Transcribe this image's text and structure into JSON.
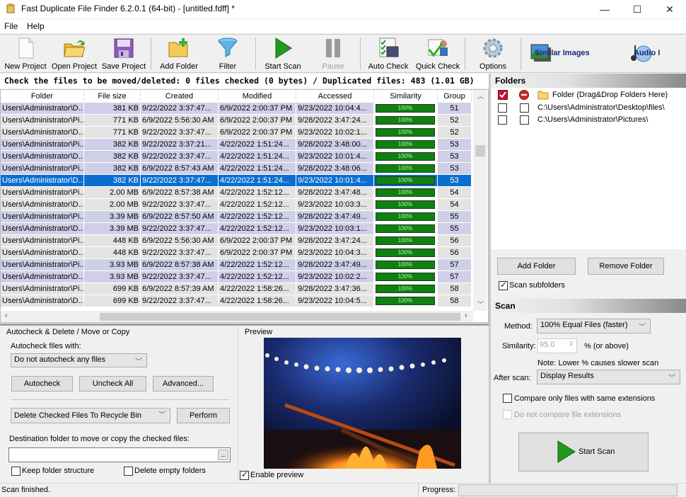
{
  "window": {
    "title": "Fast Duplicate File Finder 6.2.0.1 (64-bit) - [untitled.fdff] *",
    "minimize": "—",
    "maximize": "☐",
    "close": "✕"
  },
  "menu": [
    "File",
    "Help"
  ],
  "toolbar": {
    "buttons": [
      {
        "label": "New Project",
        "icon": "new-document-icon"
      },
      {
        "label": "Open Project",
        "icon": "open-folder-icon"
      },
      {
        "label": "Save Project",
        "icon": "save-floppy-icon"
      },
      {
        "label": "Add Folder",
        "icon": "add-folder-icon"
      },
      {
        "label": "Filter",
        "icon": "filter-funnel-icon"
      },
      {
        "label": "Start Scan",
        "icon": "play-icon"
      },
      {
        "label": "Pause",
        "icon": "pause-icon",
        "disabled": true
      },
      {
        "label": "Auto Check",
        "icon": "auto-check-icon"
      },
      {
        "label": "Quick Check",
        "icon": "quick-check-icon"
      },
      {
        "label": "Options",
        "icon": "gear-icon"
      }
    ],
    "similar_images": "Similar Images",
    "audio": "Audio I"
  },
  "status_line": "Check the files to be moved/deleted: 0 files checked (0 bytes) / Duplicated files: 483 (1.01 GB)",
  "grid": {
    "columns": [
      "Folder",
      "File size",
      "Created",
      "Modified",
      "Accessed",
      "Similarity",
      "Group"
    ],
    "rows": [
      {
        "folder": "Users\\Administrator\\D...",
        "size": "381 KB",
        "created": "9/22/2022 3:37:47...",
        "modified": "6/9/2022 2:00:37 PM",
        "accessed": "9/23/2022 10:04:4...",
        "similarity": "100%",
        "group": "51",
        "style": "alt"
      },
      {
        "folder": "Users\\Administrator\\Pi...",
        "size": "771 KB",
        "created": "6/9/2022 5:56:30 AM",
        "modified": "6/9/2022 2:00:37 PM",
        "accessed": "9/28/2022 3:47:24...",
        "similarity": "100%",
        "group": "52",
        "style": "norm"
      },
      {
        "folder": "Users\\Administrator\\D...",
        "size": "771 KB",
        "created": "9/22/2022 3:37:47...",
        "modified": "6/9/2022 2:00:37 PM",
        "accessed": "9/23/2022 10:02:1...",
        "similarity": "100%",
        "group": "52",
        "style": "norm"
      },
      {
        "folder": "Users\\Administrator\\Pi...",
        "size": "382 KB",
        "created": "9/22/2022 3:37:21...",
        "modified": "4/22/2022 1:51:24...",
        "accessed": "9/28/2022 3:48:00...",
        "similarity": "100%",
        "group": "53",
        "style": "alt"
      },
      {
        "folder": "Users\\Administrator\\D...",
        "size": "382 KB",
        "created": "9/22/2022 3:37:47...",
        "modified": "4/22/2022 1:51:24...",
        "accessed": "9/23/2022 10:01:4...",
        "similarity": "100%",
        "group": "53",
        "style": "alt"
      },
      {
        "folder": "Users\\Administrator\\Pi...",
        "size": "382 KB",
        "created": "6/9/2022 8:57:43 AM",
        "modified": "4/22/2022 1:51:24...",
        "accessed": "9/28/2022 3:48:06...",
        "similarity": "100%",
        "group": "53",
        "style": "alt"
      },
      {
        "folder": "Users\\Administrator\\D...",
        "size": "382 KB",
        "created": "9/22/2022 3:37:47...",
        "modified": "4/22/2022 1:51:24...",
        "accessed": "9/23/2022 10:01:4...",
        "similarity": "100%",
        "group": "53",
        "style": "sel"
      },
      {
        "folder": "Users\\Administrator\\Pi...",
        "size": "2.00 MB",
        "created": "6/9/2022 8:57:38 AM",
        "modified": "4/22/2022 1:52:12...",
        "accessed": "9/28/2022 3:47:48...",
        "similarity": "100%",
        "group": "54",
        "style": "norm"
      },
      {
        "folder": "Users\\Administrator\\D...",
        "size": "2.00 MB",
        "created": "9/22/2022 3:37:47...",
        "modified": "4/22/2022 1:52:12...",
        "accessed": "9/23/2022 10:03:3...",
        "similarity": "100%",
        "group": "54",
        "style": "norm"
      },
      {
        "folder": "Users\\Administrator\\Pi...",
        "size": "3.39 MB",
        "created": "6/9/2022 8:57:50 AM",
        "modified": "4/22/2022 1:52:12...",
        "accessed": "9/28/2022 3:47:49...",
        "similarity": "100%",
        "group": "55",
        "style": "alt"
      },
      {
        "folder": "Users\\Administrator\\D...",
        "size": "3.39 MB",
        "created": "9/22/2022 3:37:47...",
        "modified": "4/22/2022 1:52:12...",
        "accessed": "9/23/2022 10:03:1...",
        "similarity": "100%",
        "group": "55",
        "style": "alt"
      },
      {
        "folder": "Users\\Administrator\\Pi...",
        "size": "448 KB",
        "created": "6/9/2022 5:56:30 AM",
        "modified": "6/9/2022 2:00:37 PM",
        "accessed": "9/28/2022 3:47:24...",
        "similarity": "100%",
        "group": "56",
        "style": "norm"
      },
      {
        "folder": "Users\\Administrator\\D...",
        "size": "448 KB",
        "created": "9/22/2022 3:37:47...",
        "modified": "6/9/2022 2:00:37 PM",
        "accessed": "9/23/2022 10:04:3...",
        "similarity": "100%",
        "group": "56",
        "style": "norm"
      },
      {
        "folder": "Users\\Administrator\\Pi...",
        "size": "3.93 MB",
        "created": "6/9/2022 8:57:38 AM",
        "modified": "4/22/2022 1:52:12...",
        "accessed": "9/28/2022 3:47:49...",
        "similarity": "100%",
        "group": "57",
        "style": "alt"
      },
      {
        "folder": "Users\\Administrator\\D...",
        "size": "3.93 MB",
        "created": "9/22/2022 3:37:47...",
        "modified": "4/22/2022 1:52:12...",
        "accessed": "9/23/2022 10:02:2...",
        "similarity": "100%",
        "group": "57",
        "style": "alt"
      },
      {
        "folder": "Users\\Administrator\\Pi...",
        "size": "699 KB",
        "created": "6/9/2022 8:57:39 AM",
        "modified": "4/22/2022 1:58:26...",
        "accessed": "9/28/2022 3:47:36...",
        "similarity": "100%",
        "group": "58",
        "style": "norm"
      },
      {
        "folder": "Users\\Administrator\\D...",
        "size": "699 KB",
        "created": "9/22/2022 3:37:47...",
        "modified": "4/22/2022 1:58:26...",
        "accessed": "9/23/2022 10:04:5...",
        "similarity": "100%",
        "group": "58",
        "style": "norm"
      }
    ]
  },
  "autocheck": {
    "title": "Autocheck & Delete / Move or Copy",
    "with_label": "Autocheck files with:",
    "with_value": "Do not autocheck any files",
    "autocheck_btn": "Autocheck",
    "uncheck_btn": "Uncheck All",
    "advanced_btn": "Advanced...",
    "action_value": "Delete Checked Files To Recycle Bin",
    "perform_btn": "Perform",
    "dest_label": "Destination folder to move or copy the checked files:",
    "dest_value": "",
    "browse_btn": "...",
    "keep_structure": "Keep folder structure",
    "delete_empty": "Delete empty folders"
  },
  "preview": {
    "title": "Preview",
    "enable": "Enable preview"
  },
  "folders": {
    "title": "Folders",
    "header_label": "Folder (Drag&Drop Folders Here)",
    "items": [
      "C:\\Users\\Administrator\\Desktop\\files\\",
      "C:\\Users\\Administrator\\Pictures\\"
    ],
    "add_btn": "Add Folder",
    "remove_btn": "Remove Folder",
    "scan_subfolders": "Scan subfolders"
  },
  "scan": {
    "title": "Scan",
    "method_label": "Method:",
    "method_value": "100% Equal Files (faster)",
    "similarity_label": "Similarity:",
    "similarity_value": "95.0",
    "similarity_suffix": "% (or above)",
    "note": "Note: Lower % causes slower scan",
    "after_label": "After scan:",
    "after_value": "Display Results",
    "compare_same_ext": "Compare only files with same extensions",
    "no_compare_ext": "Do not compare file extensions",
    "start_btn": "Start Scan"
  },
  "statusbar": {
    "text": "Scan finished.",
    "progress_label": "Progress:",
    "progress": 0
  },
  "colors": {
    "selection": "#0a6ed1",
    "row_alt": "#cfcfe8",
    "row_norm": "#e3e3e3",
    "similarity_fill": "#108010",
    "link_blue": "#1a237e"
  }
}
